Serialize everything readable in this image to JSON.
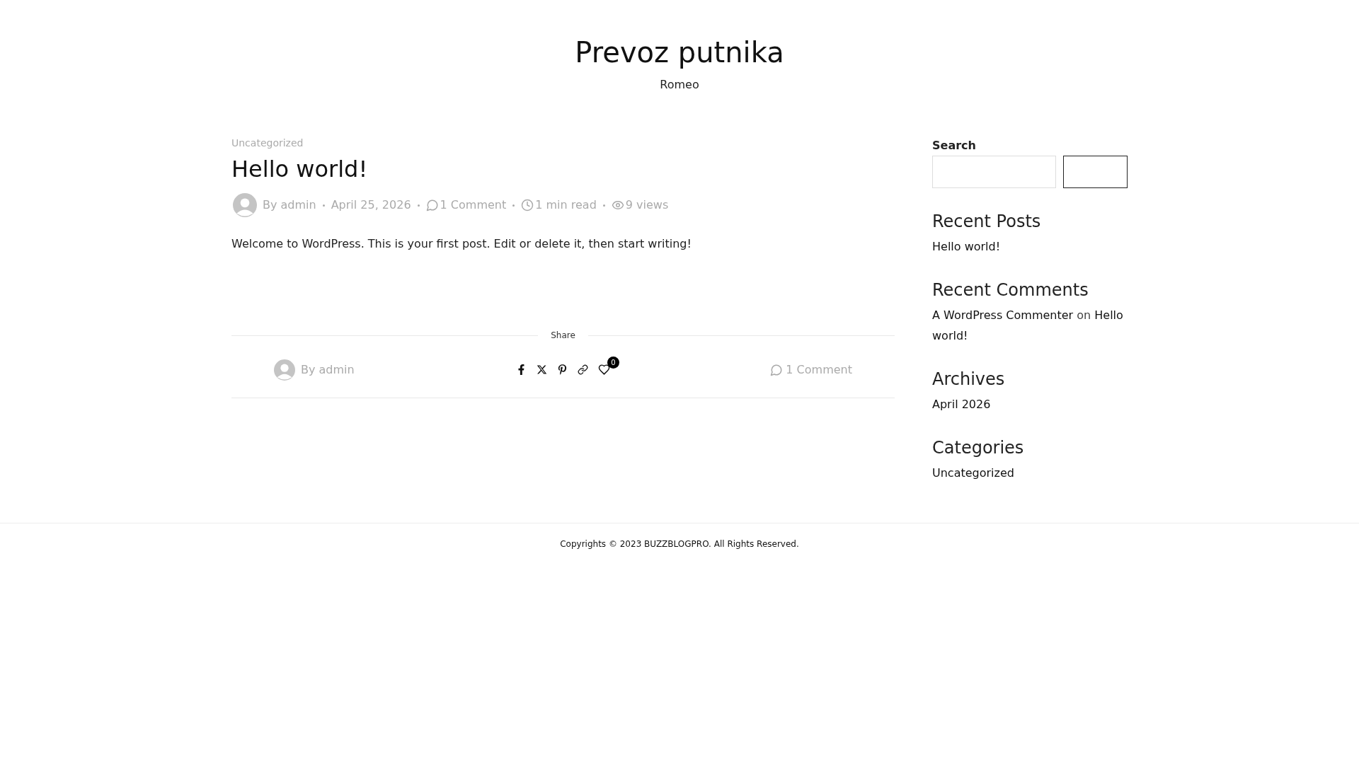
{
  "site": {
    "title": "Prevoz putnika",
    "tagline": "Romeo"
  },
  "post": {
    "category": "Uncategorized",
    "title": "Hello world!",
    "author": "By admin",
    "date": "April 25, 2026",
    "comments": "1 Comment",
    "read_time": "1 min read",
    "views": "9 views",
    "body": "Welcome to WordPress. This is your first post. Edit or delete it, then start writing!"
  },
  "share": {
    "label": "Share",
    "author": "By admin",
    "likes": "0",
    "comments": "1 Comment"
  },
  "sidebar": {
    "search_label": "Search",
    "widgets": [
      {
        "title": "Recent Posts",
        "kind": "links",
        "items": [
          "Hello world!"
        ]
      },
      {
        "title": "Recent Comments",
        "kind": "comment",
        "author": "A WordPress Commenter",
        "joiner": "on",
        "post": "Hello world!"
      },
      {
        "title": "Archives",
        "kind": "links",
        "items": [
          "April 2026"
        ]
      },
      {
        "title": "Categories",
        "kind": "links",
        "items": [
          "Uncategorized"
        ]
      }
    ]
  },
  "footer": {
    "copyright": "Copyrights © 2023 BUZZBLOGPRO. All Rights Reserved."
  }
}
